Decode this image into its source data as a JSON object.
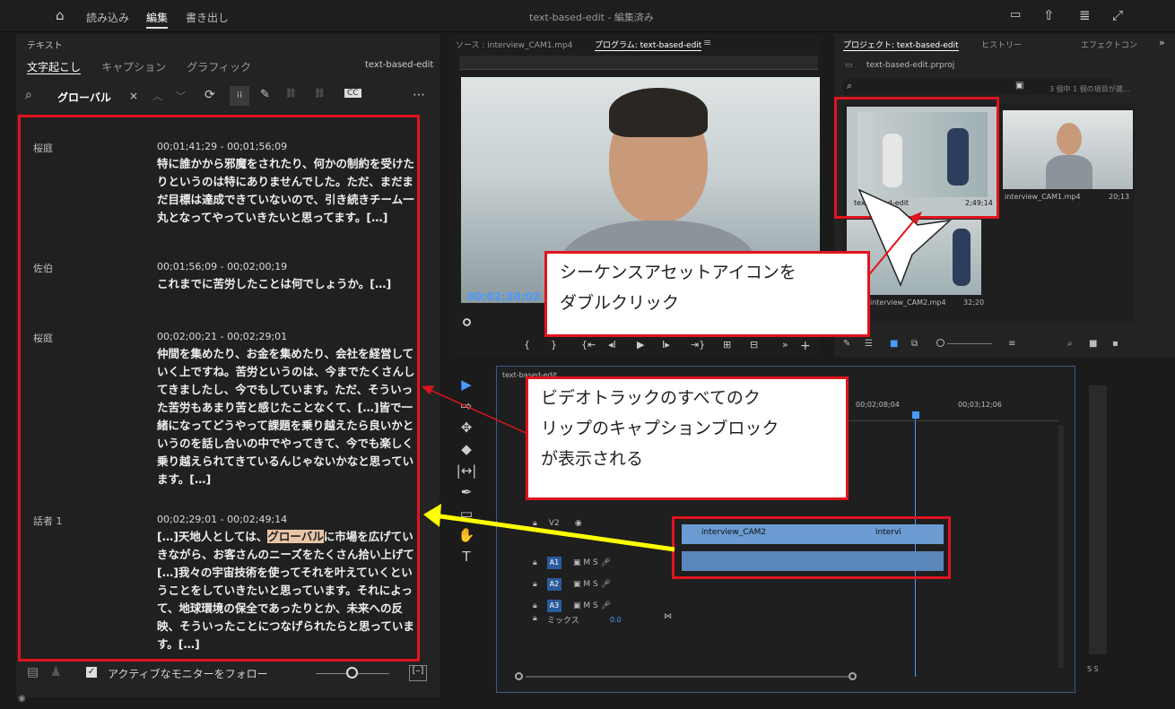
{
  "topbar": {
    "home_icon": "home-icon",
    "import": "読み込み",
    "edit": "編集",
    "export": "書き出し",
    "title": "text-based-edit - 編集済み"
  },
  "text_panel": {
    "title": "テキスト",
    "tabs": [
      "文字起こし",
      "キャプション",
      "グラフィック"
    ],
    "sequence_name": "text-based-edit",
    "search_value": "グローバル",
    "entries": [
      {
        "speaker": "桜庭",
        "timecode": "00;01;41;29 - 00;01;56;09",
        "text": "特に誰かから邪魔をされたり、何かの制約を受けたりというのは特にありませんでした。ただ、まだまだ目標は達成できていないので、引き続きチーム一丸となってやっていきたいと思ってます。[…]"
      },
      {
        "speaker": "佐伯",
        "timecode": "00;01;56;09 - 00;02;00;19",
        "text": "これまでに苦労したことは何でしょうか。[…]"
      },
      {
        "speaker": "桜庭",
        "timecode": "00;02;00;21 - 00;02;29;01",
        "text": "仲間を集めたり、お金を集めたり、会社を経営していく上ですね。苦労というのは、今までたくさんしてきましたし、今でもしています。ただ、そういった苦労もあまり苦と感じたことなくて、[…]皆で一緒になってどうやって課題を乗り越えたら良いかというのを話し合いの中でやってきて、今でも楽しく乗り越えられてきているんじゃないかなと思っています。[…]"
      },
      {
        "speaker": "話者 1",
        "timecode": "00;02;29;01 - 00;02;49;14",
        "text_before": "[…]天地人としては、",
        "highlight": "グローバル",
        "text_after": "に市場を広げていきながら、お客さんのニーズをたくさん拾い上げて[…]我々の宇宙技術を使ってそれを叶えていくということをしていきたいと思っています。それによって、地球環境の保全であったりとか、未来への反映、そういったことにつなげられたらと思っています。[…]"
      }
    ],
    "follow_label": "アクティブなモニターをフォロー"
  },
  "monitor": {
    "source_tab": "ソース : interview_CAM1.mp4",
    "program_tab": "プログラム: text-based-edit",
    "timecode": "00;02;30;02"
  },
  "project": {
    "tabs": [
      "プロジェクト: text-based-edit",
      "ヒストリー",
      "エフェクトコン"
    ],
    "file": "text-based-edit.prproj",
    "count": "3 個中 1 個の項目が選...",
    "items": [
      {
        "name": "text-based-edit",
        "duration": "2;49;14"
      },
      {
        "name": "interview_CAM1.mp4",
        "duration": "20;13"
      },
      {
        "name": "interview_CAM2.mp4",
        "duration": "32;20"
      }
    ]
  },
  "timeline": {
    "tab": "text-based-edit",
    "time_marks": [
      "00;02;08;04",
      "00;03;12;06"
    ],
    "tracks": [
      "V2",
      "A1",
      "A2",
      "A3"
    ],
    "mix": "ミックス",
    "mix_value": "0.0",
    "clip1": "interview_CAM2",
    "clip2": "intervi"
  },
  "callouts": {
    "c1": "シーケンスアセットアイコンを\nダブルクリック",
    "c2": "ビデオトラックのすべてのク\nリップのキャプションブロック\nが表示される"
  }
}
